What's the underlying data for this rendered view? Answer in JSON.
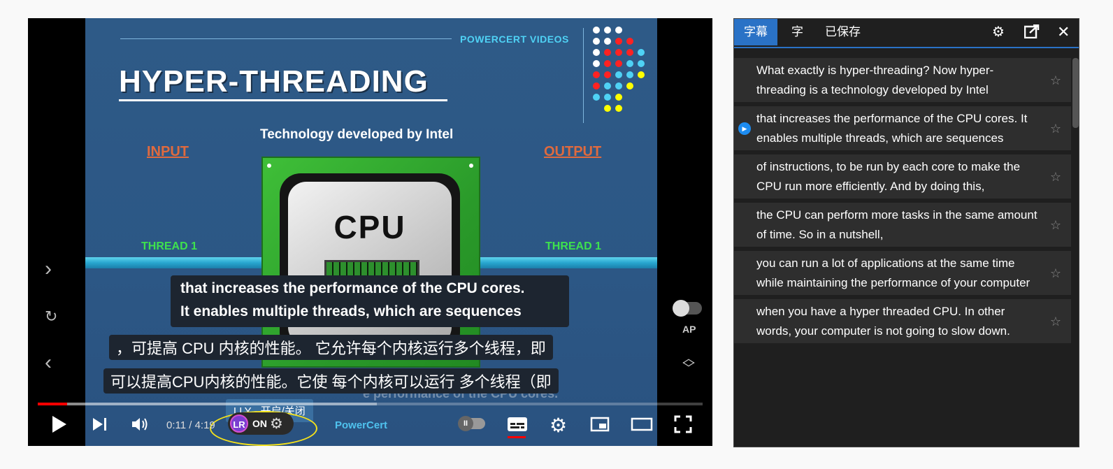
{
  "video": {
    "slide": {
      "brand": "POWERCERT VIDEOS",
      "title": "HYPER-THREADING",
      "subtitle": "Technology developed by Intel",
      "input_label": "INPUT",
      "output_label": "OUTPUT",
      "thread_left": "THREAD 1",
      "thread_right": "THREAD 1",
      "chip_label": "CPU"
    },
    "caption_en": {
      "line1": "that increases the performance of the CPU cores.",
      "line2": "It enables multiple threads, which are sequences"
    },
    "caption_zh": {
      "line1": "，可提高 CPU 内核的性能。 它允许每个内核运行多个线程，即",
      "line2": "可以提高CPU内核的性能。它使 每个内核可以运行 多个线程（即"
    },
    "ghost_caption": "e performance of the CPU cores.",
    "ap_label": "AP",
    "progress": {
      "played_fraction": 0.044,
      "buffered_fraction": 0.51
    },
    "controls": {
      "time": "0:11 / 4:19",
      "lly_on": "ON",
      "lly_logo": "LR",
      "lly_tooltip": "LLY - 开启/关闭",
      "watermark": "PowerCert",
      "pause_glyph": "II"
    },
    "colors": {
      "accent_red": "#ff0000",
      "caption_bg": "#1d2530",
      "highlight_ring": "#f5e21a"
    }
  },
  "panel": {
    "tabs": [
      {
        "label": "字幕",
        "active": true
      },
      {
        "label": "字",
        "active": false
      },
      {
        "label": "已保存",
        "active": false
      }
    ],
    "icons": [
      "gear-icon",
      "export-icon",
      "close-icon"
    ],
    "items": [
      {
        "text": "What exactly is hyper-threading? Now  hyper-threading is a technology developed by Intel",
        "playing": false
      },
      {
        "text": "that increases the performance of the CPU cores. It enables multiple threads, which are sequences",
        "playing": true
      },
      {
        "text": "of instructions, to be run by each core to make the CPU run more efficiently. And by doing this,",
        "playing": false
      },
      {
        "text": "the CPU can perform more tasks in the  same amount of time. So in a nutshell,",
        "playing": false
      },
      {
        "text": "you can run a lot of applications at the same time  while maintaining the performance of your computer",
        "playing": false
      },
      {
        "text": "when you have a hyper threaded CPU. In other words, your computer is not going to slow down.",
        "playing": false
      }
    ],
    "accent": "#2a72c6"
  }
}
